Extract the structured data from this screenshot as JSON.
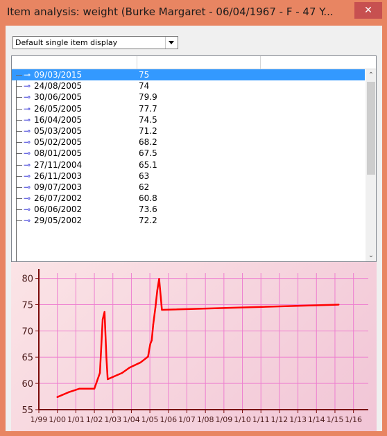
{
  "window": {
    "title": "Item analysis: weight (Burke Margaret - 06/04/1967 - F - 47 Y...",
    "close_label": "✕"
  },
  "display_select": {
    "value": "Default single item display"
  },
  "list": {
    "rows": [
      {
        "date": "09/03/2015",
        "value": "75",
        "selected": true
      },
      {
        "date": "24/08/2005",
        "value": "74"
      },
      {
        "date": "30/06/2005",
        "value": "79.9"
      },
      {
        "date": "26/05/2005",
        "value": "77.7"
      },
      {
        "date": "16/04/2005",
        "value": "74.5"
      },
      {
        "date": "05/03/2005",
        "value": "71.2"
      },
      {
        "date": "05/02/2005",
        "value": "68.2"
      },
      {
        "date": "08/01/2005",
        "value": "67.5"
      },
      {
        "date": "27/11/2004",
        "value": "65.1"
      },
      {
        "date": "26/11/2003",
        "value": "63"
      },
      {
        "date": "09/07/2003",
        "value": "62"
      },
      {
        "date": "26/07/2002",
        "value": "60.8"
      },
      {
        "date": "06/06/2002",
        "value": "73.6"
      },
      {
        "date": "29/05/2002",
        "value": "72.2"
      }
    ]
  },
  "chart_data": {
    "type": "line",
    "color": "#ff0000",
    "grid": true,
    "ylim": [
      55,
      81
    ],
    "yticks": [
      55,
      60,
      65,
      70,
      75,
      80
    ],
    "xticks": [
      "1/99",
      "1/00",
      "1/01",
      "1/02",
      "1/03",
      "1/04",
      "1/05",
      "1/06",
      "1/07",
      "1/08",
      "1/09",
      "1/10",
      "1/11",
      "1/12",
      "1/13",
      "1/14",
      "1/15",
      "1/16"
    ],
    "xlim": [
      1999,
      2016.8
    ],
    "points": [
      [
        2000.0,
        57.4
      ],
      [
        2000.6,
        58.3
      ],
      [
        2001.2,
        59.0
      ],
      [
        2002.0,
        59.0
      ],
      [
        2002.3,
        62.0
      ],
      [
        2002.45,
        72.2
      ],
      [
        2002.55,
        73.6
      ],
      [
        2002.65,
        65.0
      ],
      [
        2002.72,
        60.8
      ],
      [
        2003.5,
        62.0
      ],
      [
        2003.9,
        63.0
      ],
      [
        2004.5,
        64.0
      ],
      [
        2004.9,
        65.1
      ],
      [
        2005.02,
        67.5
      ],
      [
        2005.1,
        68.2
      ],
      [
        2005.18,
        71.2
      ],
      [
        2005.3,
        74.5
      ],
      [
        2005.4,
        77.7
      ],
      [
        2005.5,
        79.9
      ],
      [
        2005.65,
        74.0
      ],
      [
        2015.2,
        75.0
      ]
    ]
  }
}
